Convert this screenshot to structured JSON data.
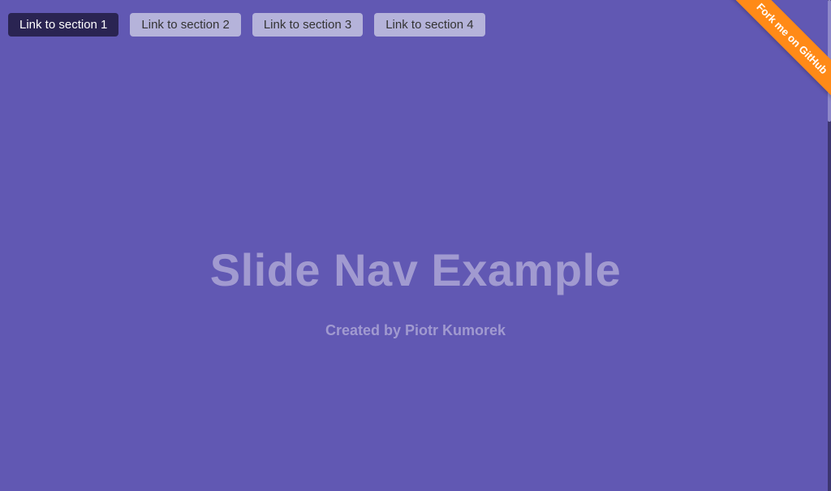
{
  "nav": {
    "items": [
      {
        "label": "Link to section 1",
        "active": true
      },
      {
        "label": "Link to section 2",
        "active": false
      },
      {
        "label": "Link to section 3",
        "active": false
      },
      {
        "label": "Link to section 4",
        "active": false
      }
    ]
  },
  "hero": {
    "title": "Slide Nav Example",
    "subtitle": "Created by Piotr Kumorek"
  },
  "ribbon": {
    "label": "Fork me on GitHub"
  },
  "colors": {
    "background": "#6158b3",
    "nav_active_bg": "#2a2452",
    "nav_inactive_bg": "#b5b3da",
    "ribbon_bg": "#ff8a17",
    "hero_text": "#a19ad0"
  }
}
